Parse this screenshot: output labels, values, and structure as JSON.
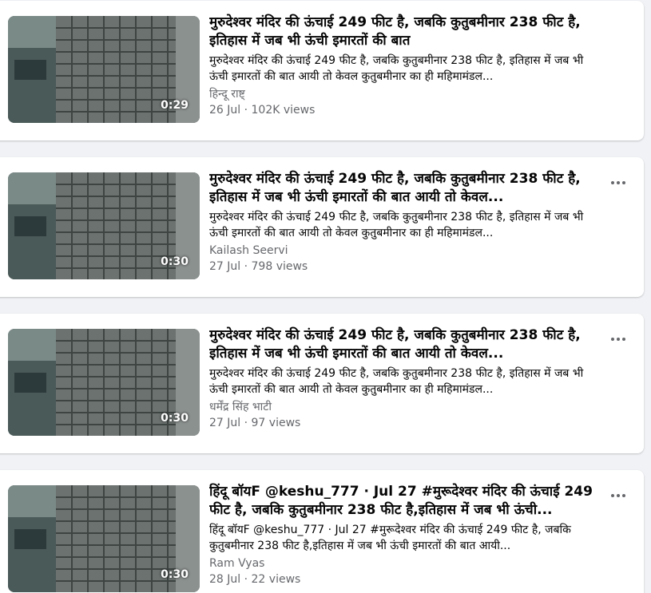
{
  "videos": [
    {
      "duration": "0:29",
      "title": "मुरुदेश्वर मंदिर की ऊंचाई 249 फीट है, जबकि कुतुबमीनार 238 फीट है, इतिहास में जब भी ऊंची इमारतों की बात",
      "description": "मुरुदेश्वर मंदिर की ऊंचाई 249 फीट है, जबकि कुतुबमीनार 238 फीट है, इतिहास में जब भी ऊंची इमारतों की बात आयी तो केवल कुतुबमीनार का ही महिमामंडल...",
      "author": "हिन्दू राष्ट्",
      "date": "26 Jul",
      "views": "102K views",
      "has_more_button": false
    },
    {
      "duration": "0:30",
      "title": "मुरुदेश्वर मंदिर की ऊंचाई 249 फीट है, जबकि कुतुबमीनार 238 फीट है, इतिहास में जब भी ऊंची इमारतों की बात आयी तो केवल...",
      "description": "मुरुदेश्वर मंदिर की ऊंचाई 249 फीट है, जबकि कुतुबमीनार 238 फीट है, इतिहास में जब भी ऊंची इमारतों की बात आयी तो केवल कुतुबमीनार का ही महिमामंडल...",
      "author": "Kailash Seervi",
      "date": "27 Jul",
      "views": "798 views",
      "has_more_button": true
    },
    {
      "duration": "0:30",
      "title": "मुरुदेश्वर मंदिर की ऊंचाई 249 फीट है, जबकि कुतुबमीनार 238 फीट है, इतिहास में जब भी ऊंची इमारतों की बात आयी तो केवल...",
      "description": "मुरुदेश्वर मंदिर की ऊंचाई 249 फीट है, जबकि कुतुबमीनार 238 फीट है, इतिहास में जब भी ऊंची इमारतों की बात आयी तो केवल कुतुबमीनार का ही महिमामंडल...",
      "author": "धर्मेंद्र सिंह भाटी",
      "date": "27 Jul",
      "views": "97 views",
      "has_more_button": true
    },
    {
      "duration": "0:30",
      "title": "हिंदू बॉयF @keshu_777 · Jul 27 #मुरूदेश्वर मंदिर की ऊंचाई 249 फीट है, जबकि कुतुबमीनार 238 फीट है,इतिहास में जब भी ऊंची...",
      "description": "हिंदू बॉयF @keshu_777 · Jul 27 #मुरूदेश्वर मंदिर की ऊंचाई 249 फीट है, जबकि कुतुबमीनार 238 फीट है,इतिहास में जब भी ऊंची इमारतों की बात आयी...",
      "author": "Ram Vyas",
      "date": "28 Jul",
      "views": "22 views",
      "has_more_button": true
    }
  ],
  "separator": " · ",
  "colors": {
    "background": "#f0f2f5",
    "card": "#ffffff",
    "primary_text": "#050505",
    "secondary_text": "#65676b"
  },
  "icons": {
    "more": "more-horizontal-icon"
  }
}
